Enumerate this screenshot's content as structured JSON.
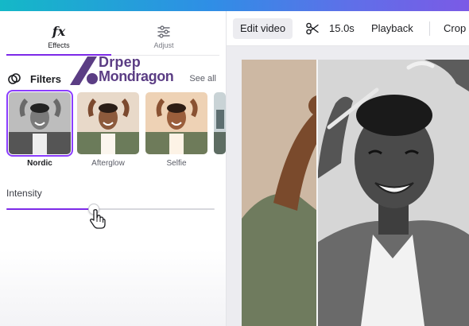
{
  "left_panel": {
    "tabs": [
      {
        "label": "Effects",
        "icon": "fx-icon",
        "active": true
      },
      {
        "label": "Adjust",
        "icon": "sliders-icon",
        "active": false
      }
    ],
    "fx_glyph": "fx",
    "watermark": {
      "line1": "Drpep",
      "line2": "Mondragon"
    },
    "filters": {
      "title": "Filters",
      "see_all": "See all",
      "items": [
        {
          "label": "Nordic",
          "selected": true
        },
        {
          "label": "Afterglow",
          "selected": false
        },
        {
          "label": "Selfie",
          "selected": false
        }
      ]
    },
    "intensity": {
      "label": "Intensity",
      "value_fraction": 0.42
    }
  },
  "toolbar": {
    "edit_video": "Edit video",
    "duration": "15.0s",
    "playback": "Playback",
    "crop": "Crop"
  },
  "colors": {
    "accent": "#7d2ae8",
    "selected_outline": "#8b3dff",
    "watermark": "#5b3d84",
    "toolbar_button_bg": "#ececf0"
  }
}
